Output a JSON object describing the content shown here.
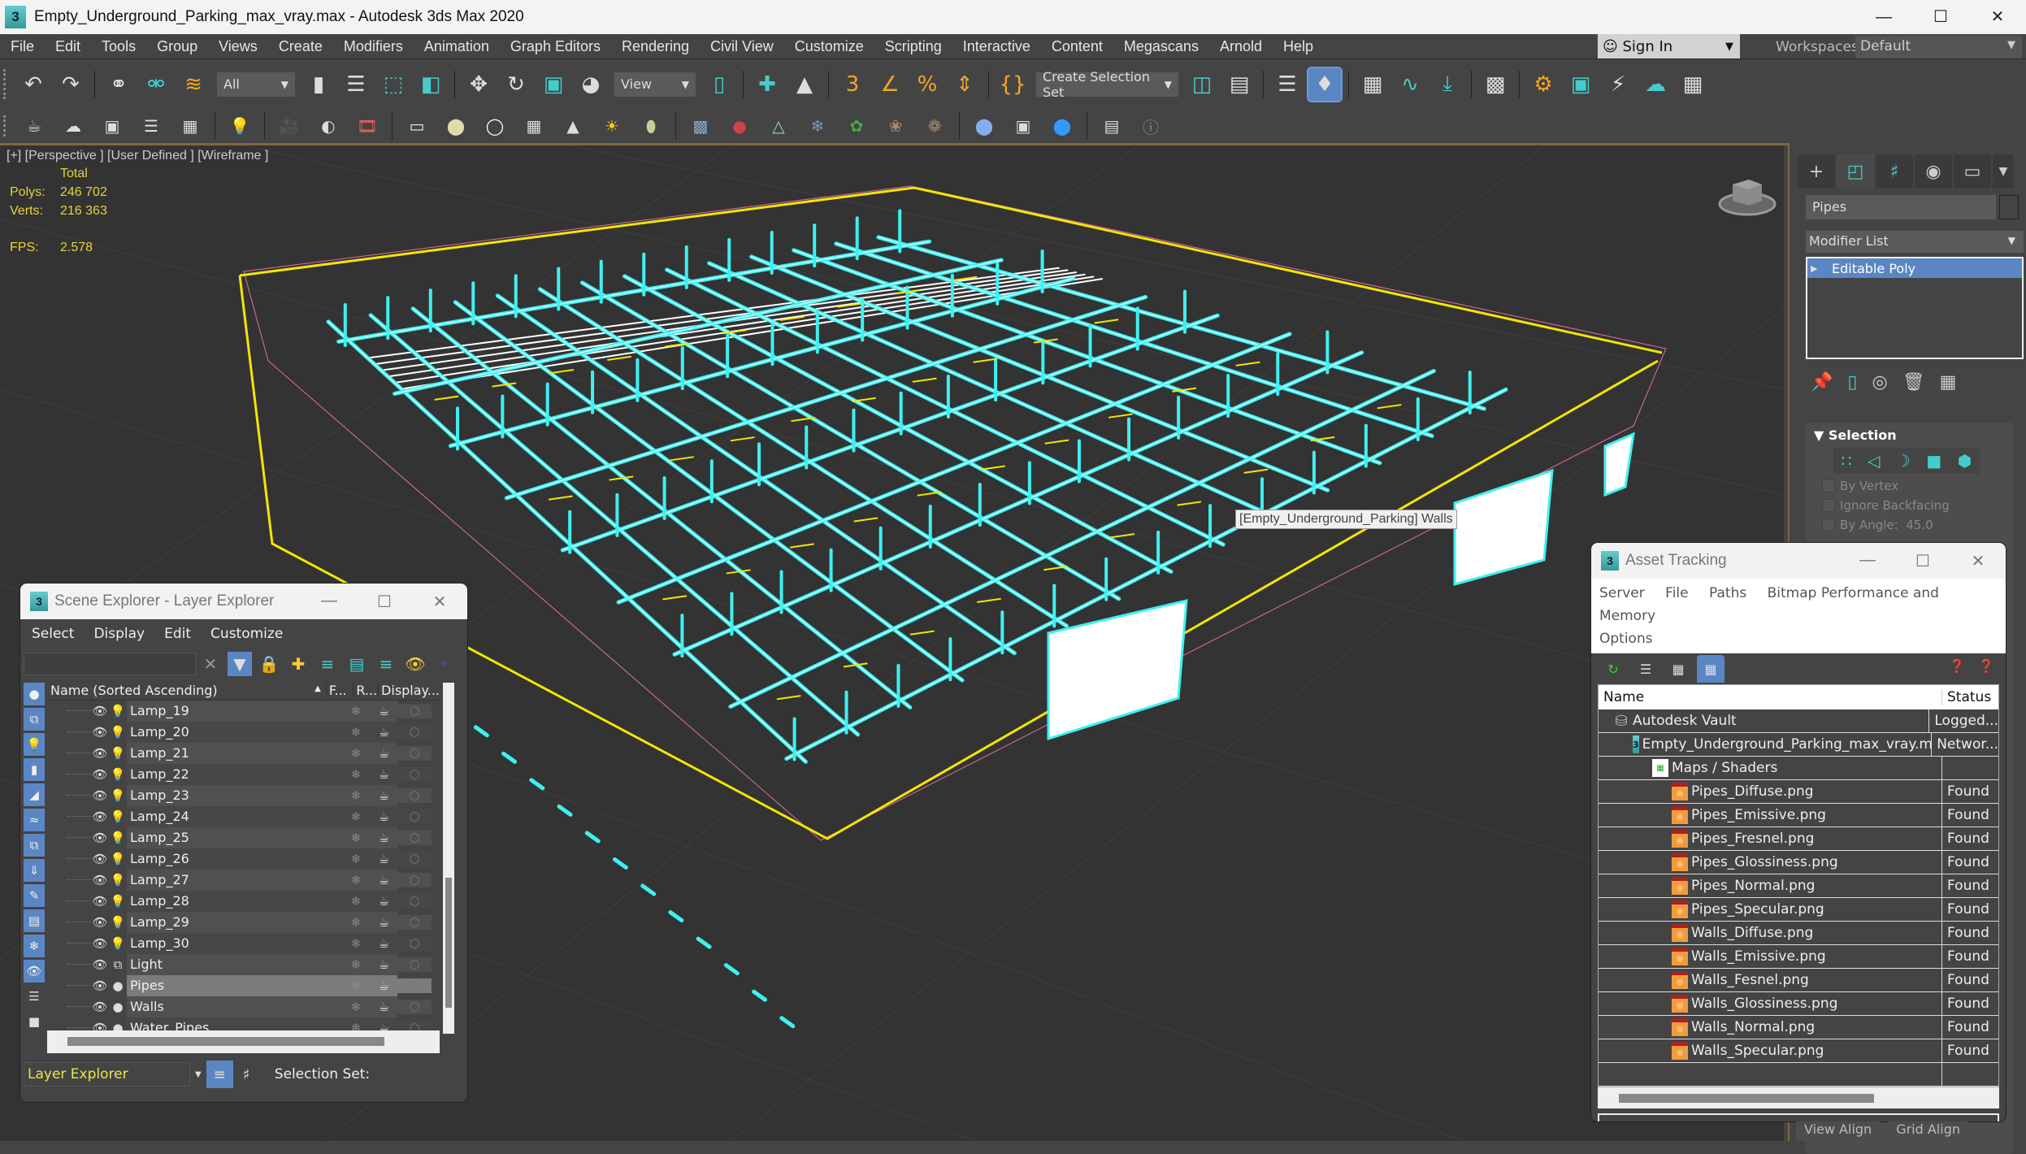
{
  "window": {
    "title": "Empty_Underground_Parking_max_vray.max - Autodesk 3ds Max 2020",
    "app_icon": "3ds-max-icon",
    "controls": [
      "minimize",
      "maximize",
      "close"
    ]
  },
  "menubar": {
    "items": [
      "File",
      "Edit",
      "Tools",
      "Group",
      "Views",
      "Create",
      "Modifiers",
      "Animation",
      "Graph Editors",
      "Rendering",
      "Civil View",
      "Customize",
      "Scripting",
      "Interactive",
      "Content",
      "Megascans",
      "Arnold",
      "Help"
    ],
    "sign_in": "Sign In",
    "workspaces_label": "Workspaces:",
    "workspace_value": "Default"
  },
  "toolbar": {
    "selection_filter": "All",
    "reference_coord": "View",
    "named_selection": "Create Selection Set",
    "row1_icons": [
      "undo-icon",
      "redo-icon",
      "link-icon",
      "unlink-icon",
      "bind-space-warp-icon",
      "select-object-icon",
      "select-by-name-icon",
      "rect-selection-icon",
      "window-crossing-icon",
      "move-icon",
      "rotate-icon",
      "scale-icon",
      "place-icon",
      "pivot-icon",
      "manipulate-icon",
      "keyboard-shortcut-icon",
      "snap-3d-icon",
      "angle-snap-icon",
      "percent-snap-icon",
      "spinner-snap-icon",
      "edit-named-sets-icon",
      "mirror-icon",
      "align-icon",
      "scene-explorer-icon",
      "layer-explorer-icon",
      "ribbon-icon",
      "curve-editor-icon",
      "schematic-view-icon",
      "material-editor-icon",
      "render-setup-icon",
      "rendered-frame-icon",
      "render-icon",
      "render-cloud-icon",
      "a360-gallery-icon"
    ],
    "row2_icons": [
      "teapot-icon",
      "cloud-icon",
      "render-window-icon",
      "list-icon",
      "table-icon",
      "light-lister-icon",
      "camera-icon",
      "camera-lens-icon",
      "camera-sequence-icon",
      "plane-light-icon",
      "sphere-light-icon",
      "omni-light-icon",
      "mesh-light-icon",
      "spot-light-icon",
      "sun-icon",
      "dome-light-icon",
      "proxy-icon",
      "vray-sphere-icon",
      "fur-icon",
      "grass-icon",
      "hair-icon",
      "ox-icon",
      "material-sphere-icon",
      "vray-vfb-icon",
      "render-elements-icon",
      "vray-log-icon",
      "help-icon"
    ]
  },
  "viewport": {
    "label": "[+] [Perspective ] [User Defined ] [Wireframe ]",
    "stats_header": "Total",
    "stats": [
      {
        "label": "Polys:",
        "value": "246 702"
      },
      {
        "label": "Verts:",
        "value": "216 363"
      }
    ],
    "fps_label": "FPS:",
    "fps_value": "2.578",
    "tooltip": "[Empty_Underground_Parking] Walls",
    "colors": {
      "selection_box": "#f2e600",
      "pipes": "#3ff0f0",
      "background": "#333333"
    }
  },
  "command_panel": {
    "tabs": [
      "create-icon",
      "modify-icon",
      "hierarchy-icon",
      "motion-icon",
      "display-icon",
      "utilities-icon"
    ],
    "object_name": "Pipes",
    "modifier_list": "Modifier List",
    "stack": [
      "Editable Poly"
    ],
    "rollout_title": "Selection",
    "options": [
      "By Vertex",
      "Ignore Backfacing",
      "By Angle:"
    ],
    "by_angle_value": "45.0",
    "bottom_buttons": [
      "View Align",
      "Grid Align"
    ]
  },
  "scene_explorer": {
    "title": "Scene Explorer - Layer Explorer",
    "menu": [
      "Select",
      "Display",
      "Edit",
      "Customize"
    ],
    "search_placeholder": "",
    "columns": [
      "Name (Sorted Ascending)",
      "F...",
      "R...",
      "Display..."
    ],
    "rows": [
      {
        "name": "Lamp_19",
        "type": "light"
      },
      {
        "name": "Lamp_20",
        "type": "light"
      },
      {
        "name": "Lamp_21",
        "type": "light"
      },
      {
        "name": "Lamp_22",
        "type": "light"
      },
      {
        "name": "Lamp_23",
        "type": "light"
      },
      {
        "name": "Lamp_24",
        "type": "light"
      },
      {
        "name": "Lamp_25",
        "type": "light"
      },
      {
        "name": "Lamp_26",
        "type": "light"
      },
      {
        "name": "Lamp_27",
        "type": "light"
      },
      {
        "name": "Lamp_28",
        "type": "light"
      },
      {
        "name": "Lamp_29",
        "type": "light"
      },
      {
        "name": "Lamp_30",
        "type": "light"
      },
      {
        "name": "Light",
        "type": "group"
      },
      {
        "name": "Pipes",
        "type": "object",
        "selected": true
      },
      {
        "name": "Walls",
        "type": "object"
      },
      {
        "name": "Water_Pipes",
        "type": "object"
      }
    ],
    "explorer_type": "Layer Explorer",
    "selection_set_label": "Selection Set:"
  },
  "asset_tracking": {
    "title": "Asset Tracking",
    "menu": [
      "Server",
      "File",
      "Paths",
      "Bitmap Performance and Memory",
      "Options"
    ],
    "columns": [
      "Name",
      "Status"
    ],
    "rows": [
      {
        "name": "Autodesk Vault",
        "status": "Logged...",
        "level": 1,
        "icon": "vault"
      },
      {
        "name": "Empty_Underground_Parking_max_vray.max",
        "status": "Networ...",
        "level": 2,
        "icon": "max"
      },
      {
        "name": "Maps / Shaders",
        "status": "",
        "level": 3,
        "icon": "maps"
      },
      {
        "name": "Pipes_Diffuse.png",
        "status": "Found",
        "level": 4,
        "icon": "png"
      },
      {
        "name": "Pipes_Emissive.png",
        "status": "Found",
        "level": 4,
        "icon": "png"
      },
      {
        "name": "Pipes_Fresnel.png",
        "status": "Found",
        "level": 4,
        "icon": "png"
      },
      {
        "name": "Pipes_Glossiness.png",
        "status": "Found",
        "level": 4,
        "icon": "png"
      },
      {
        "name": "Pipes_Normal.png",
        "status": "Found",
        "level": 4,
        "icon": "png"
      },
      {
        "name": "Pipes_Specular.png",
        "status": "Found",
        "level": 4,
        "icon": "png"
      },
      {
        "name": "Walls_Diffuse.png",
        "status": "Found",
        "level": 4,
        "icon": "png"
      },
      {
        "name": "Walls_Emissive.png",
        "status": "Found",
        "level": 4,
        "icon": "png"
      },
      {
        "name": "Walls_Fesnel.png",
        "status": "Found",
        "level": 4,
        "icon": "png"
      },
      {
        "name": "Walls_Glossiness.png",
        "status": "Found",
        "level": 4,
        "icon": "png"
      },
      {
        "name": "Walls_Normal.png",
        "status": "Found",
        "level": 4,
        "icon": "png"
      },
      {
        "name": "Walls_Specular.png",
        "status": "Found",
        "level": 4,
        "icon": "png"
      }
    ]
  }
}
